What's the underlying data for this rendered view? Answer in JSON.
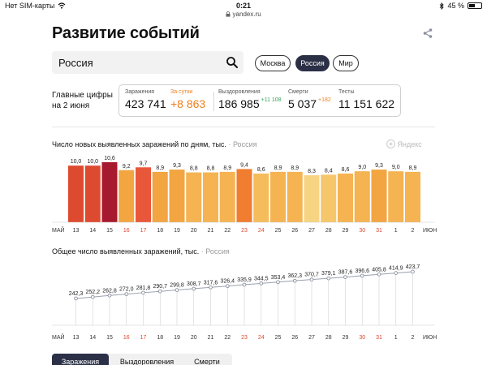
{
  "status_bar": {
    "carrier": "Нет SIM-карты",
    "time": "0:21",
    "battery": "45 %",
    "battery_level": 0.45
  },
  "browser": {
    "url": "yandex.ru"
  },
  "page": {
    "title": "Развитие событий"
  },
  "search": {
    "value": "Россия"
  },
  "region_chips": [
    {
      "label": "Москва",
      "active": false
    },
    {
      "label": "Россия",
      "active": true
    },
    {
      "label": "Мир",
      "active": false
    }
  ],
  "summary": {
    "label_line1": "Главные цифры",
    "label_line2": "на 2 июня",
    "stats": [
      {
        "label": "Заражения",
        "value": "423 741",
        "delta": ""
      },
      {
        "label": "За сутки",
        "value": "+8 863",
        "delta": ""
      },
      {
        "label": "Выздоровления",
        "value": "186 985",
        "delta": "+11 108"
      },
      {
        "label": "Смерти",
        "value": "5 037",
        "delta": "+182"
      },
      {
        "label": "Тесты",
        "value": "11 151 622",
        "delta": ""
      }
    ]
  },
  "chart_data": [
    {
      "type": "bar",
      "title": "Число новых выявленных заражений по дням, тыс.",
      "region": "Россия",
      "watermark": "Яндекс",
      "month_start": "МАЙ",
      "month_end": "ИЮН",
      "categories": [
        "13",
        "14",
        "15",
        "16",
        "17",
        "18",
        "19",
        "20",
        "21",
        "22",
        "23",
        "24",
        "25",
        "26",
        "27",
        "28",
        "29",
        "30",
        "31",
        "1",
        "2"
      ],
      "weekend_days": [
        "16",
        "17",
        "23",
        "24",
        "30",
        "31"
      ],
      "values": [
        10.0,
        10.0,
        10.6,
        9.2,
        9.7,
        8.9,
        9.3,
        8.8,
        8.8,
        8.9,
        9.4,
        8.6,
        8.9,
        8.9,
        8.3,
        8.4,
        8.6,
        9.0,
        9.3,
        9.0,
        8.9
      ],
      "value_labels": [
        "10,0",
        "10,0",
        "10,6",
        "9,2",
        "9,7",
        "8,9",
        "9,3",
        "8,8",
        "8,8",
        "8,9",
        "9,4",
        "8,6",
        "8,9",
        "8,9",
        "8,3",
        "8,4",
        "8,6",
        "9,0",
        "9,3",
        "9,0",
        "8,9"
      ],
      "bar_colors": [
        "#de4a2f",
        "#de4a2f",
        "#a6192e",
        "#f2a541",
        "#e9573a",
        "#f2a541",
        "#f2a541",
        "#f5b352",
        "#f5b352",
        "#f5b352",
        "#f07d30",
        "#f5bc5c",
        "#f5b352",
        "#f5b352",
        "#f7d482",
        "#f6c66a",
        "#f5b352",
        "#f5b352",
        "#f2a541",
        "#f5b352",
        "#f5b352"
      ],
      "ylim": [
        0,
        10.6
      ]
    },
    {
      "type": "line",
      "title": "Общее число выявленных заражений, тыс.",
      "region": "Россия",
      "month_start": "МАЙ",
      "month_end": "ИЮН",
      "categories": [
        "13",
        "14",
        "15",
        "16",
        "17",
        "18",
        "19",
        "20",
        "21",
        "22",
        "23",
        "24",
        "25",
        "26",
        "27",
        "28",
        "29",
        "30",
        "31",
        "1",
        "2"
      ],
      "weekend_days": [
        "16",
        "17",
        "23",
        "24",
        "30",
        "31"
      ],
      "values": [
        242.3,
        252.2,
        262.8,
        272.0,
        281.8,
        290.7,
        299.8,
        308.7,
        317.6,
        326.4,
        335.9,
        344.5,
        353.4,
        362.3,
        370.7,
        379.1,
        387.6,
        396.6,
        405.8,
        414.9,
        423.7
      ],
      "value_labels": [
        "242,3",
        "252,2",
        "262,8",
        "272,0",
        "281,8",
        "290,7",
        "299,8",
        "308,7",
        "317,6",
        "326,4",
        "335,9",
        "344,5",
        "353,4",
        "362,3",
        "370,7",
        "379,1",
        "387,6",
        "396,6",
        "405,8",
        "414,9",
        "423,7"
      ],
      "ylim": [
        0,
        423.7
      ]
    }
  ],
  "bottom_tabs": [
    {
      "label": "Заражения",
      "active": true
    },
    {
      "label": "Выздоровления",
      "active": false
    },
    {
      "label": "Смерти",
      "active": false
    }
  ],
  "colors": {
    "accent_dark": "#2b3046",
    "orange": "#f07d1d",
    "green": "#3aa35a",
    "weekend_red": "#e0432c"
  }
}
